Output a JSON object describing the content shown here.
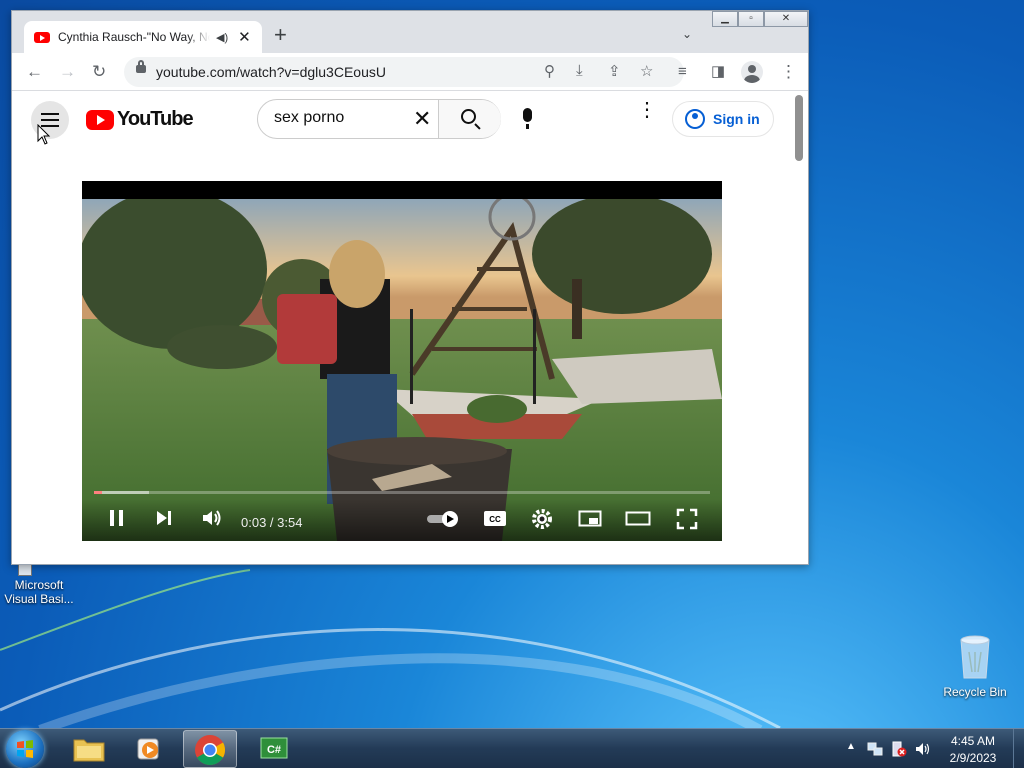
{
  "browser": {
    "tab_title": "Cynthia Rausch-\"No Way, No",
    "url": "youtube.com/watch?v=dglu3CEousU"
  },
  "youtube": {
    "logo_text": "YouTube",
    "search_value": "sex porno",
    "signin_label": "Sign in"
  },
  "player": {
    "time": "0:03 / 3:54",
    "progress_fraction": 0.013
  },
  "desktop": {
    "icons": [
      {
        "label": "Microsoft Visual Basi..."
      },
      {
        "label": "Recycle Bin"
      }
    ]
  },
  "taskbar": {
    "time": "4:45 AM",
    "date": "2/9/2023"
  },
  "colors": {
    "yt_red": "#ff0000",
    "signin_blue": "#065fd4",
    "chrome_tabstrip": "#dee1e6"
  }
}
